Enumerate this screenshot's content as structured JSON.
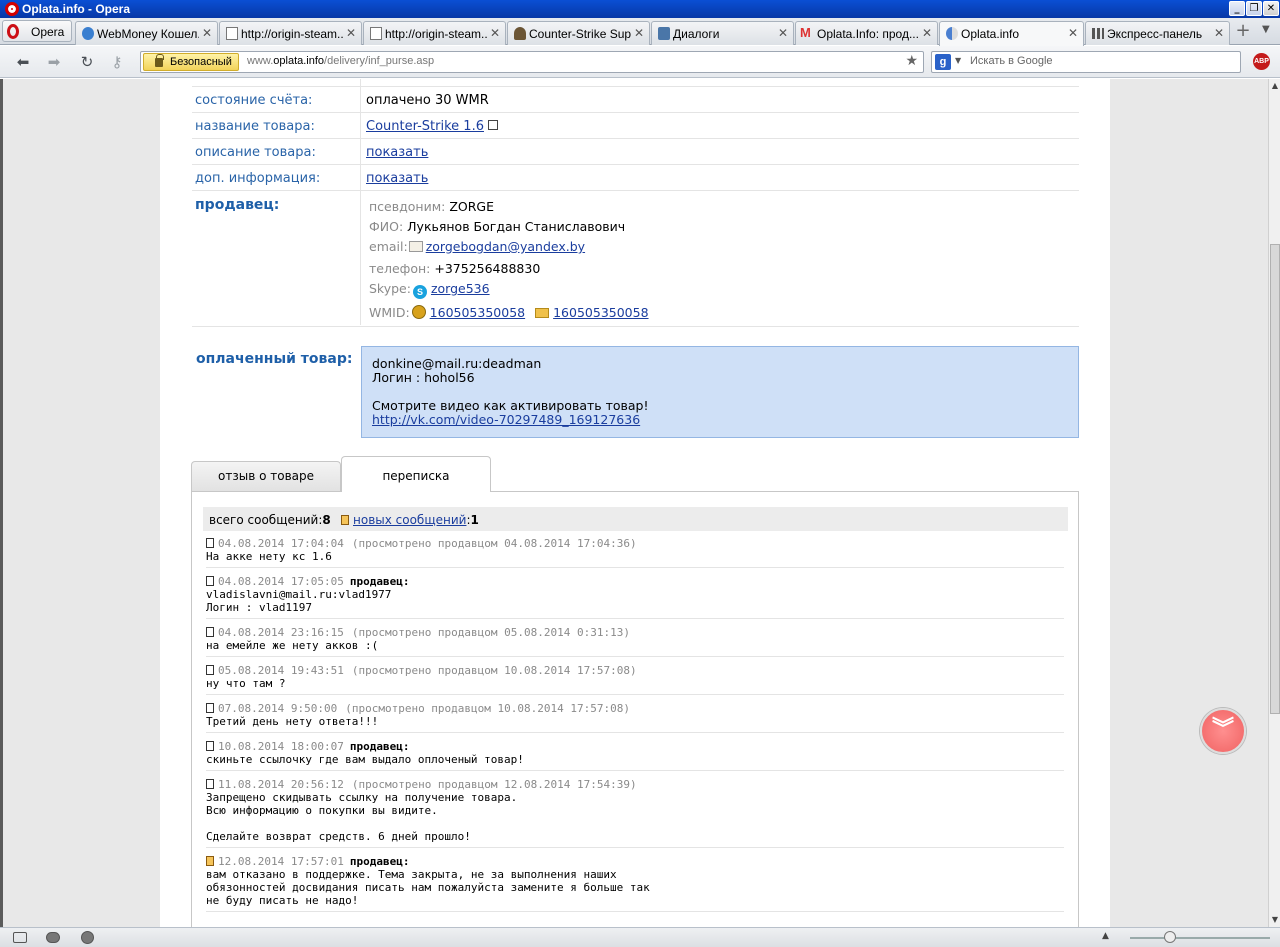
{
  "window": {
    "title": "Oplata.info - Opera"
  },
  "opera_button": {
    "label": "Opera"
  },
  "tabs": [
    {
      "label": "WebMoney Кошел..."
    },
    {
      "label": "http://origin-steam..."
    },
    {
      "label": "http://origin-steam..."
    },
    {
      "label": "Counter-Strike Sup..."
    },
    {
      "label": "Диалоги"
    },
    {
      "label": "Oplata.Info: прод..."
    },
    {
      "label": "Oplata.info"
    },
    {
      "label": "Экспресс-панель"
    }
  ],
  "address": {
    "security_label": "Безопасный",
    "url_prefix": "www.",
    "url_domain": "oplata.info",
    "url_path": "/delivery/inf_purse.asp"
  },
  "search": {
    "placeholder": "Искать в Google",
    "engine_letter": "g"
  },
  "adblock": {
    "label": "ABP"
  },
  "info": {
    "account_state_label": "состояние счёта:",
    "account_state_value": "оплачено 30 WMR",
    "product_name_label": "название товара:",
    "product_name_value": "Counter-Strike 1.6",
    "product_desc_label": "описание товара:",
    "product_desc_value": "показать",
    "extra_info_label": "доп. информация:",
    "extra_info_value": "показать"
  },
  "seller": {
    "label": "продавец:",
    "nickname_label": "псевдоним:",
    "nickname": "ZORGE",
    "fio_label": "ФИО:",
    "fio": "Лукьянов Богдан Станиславович",
    "email_label": "email:",
    "email": "zorgebogdan@yandex.by",
    "phone_label": "телефон:",
    "phone": "+375256488830",
    "skype_label": "Skype:",
    "skype": "zorge536",
    "wmid_label": "WMID:",
    "wmid_1": "160505350058",
    "wmid_2": "160505350058"
  },
  "paid": {
    "label": "оплаченный товар:",
    "line1": "donkine@mail.ru:deadman",
    "line2": "Логин : hohol56",
    "line3": "Смотрите видео как активировать товар!",
    "link": "http://vk.com/video-70297489_169127636"
  },
  "page_tabs": {
    "review": "отзыв о товаре",
    "correspondence": "переписка"
  },
  "summary": {
    "total_label": "всего сообщений:",
    "total": "8",
    "new_label": "новых сообщений",
    "new_count": "1"
  },
  "messages": [
    {
      "date": "04.08.2014 17:04:04",
      "viewed": "(просмотрено продавцом 04.08.2014 17:04:36)",
      "seller": "",
      "body": "На акке нету кс 1.6"
    },
    {
      "date": "04.08.2014 17:05:05",
      "viewed": "",
      "seller": "продавец:",
      "body": "vladislavni@mail.ru:vlad1977\nЛогин : vlad1197"
    },
    {
      "date": "04.08.2014 23:16:15",
      "viewed": "(просмотрено продавцом 05.08.2014 0:31:13)",
      "seller": "",
      "body": "на емейле же нету акков :("
    },
    {
      "date": "05.08.2014 19:43:51",
      "viewed": "(просмотрено продавцом 10.08.2014 17:57:08)",
      "seller": "",
      "body": "ну что там ?"
    },
    {
      "date": "07.08.2014 9:50:00",
      "viewed": "(просмотрено продавцом 10.08.2014 17:57:08)",
      "seller": "",
      "body": "Третий день нету ответа!!!"
    },
    {
      "date": "10.08.2014 18:00:07",
      "viewed": "",
      "seller": "продавец:",
      "body": "скиньте ссылочку где вам выдало оплоченый товар!"
    },
    {
      "date": "11.08.2014 20:56:12",
      "viewed": "(просмотрено продавцом 12.08.2014 17:54:39)",
      "seller": "",
      "body": "Запрещено скидывать ссылку на получение товара.\nВсю информацию о покупки вы видите.\n\nСделайте возврат средств. 6 дней прошло!"
    },
    {
      "date": "12.08.2014 17:57:01",
      "viewed": "",
      "seller": "продавец:",
      "body": "вам отказано в поддержке. Тема закрыта, не за выполнения наших\nобязонностей досвидания писать нам пожалуйста замените я больше так\nне буду писать не надо!"
    }
  ]
}
